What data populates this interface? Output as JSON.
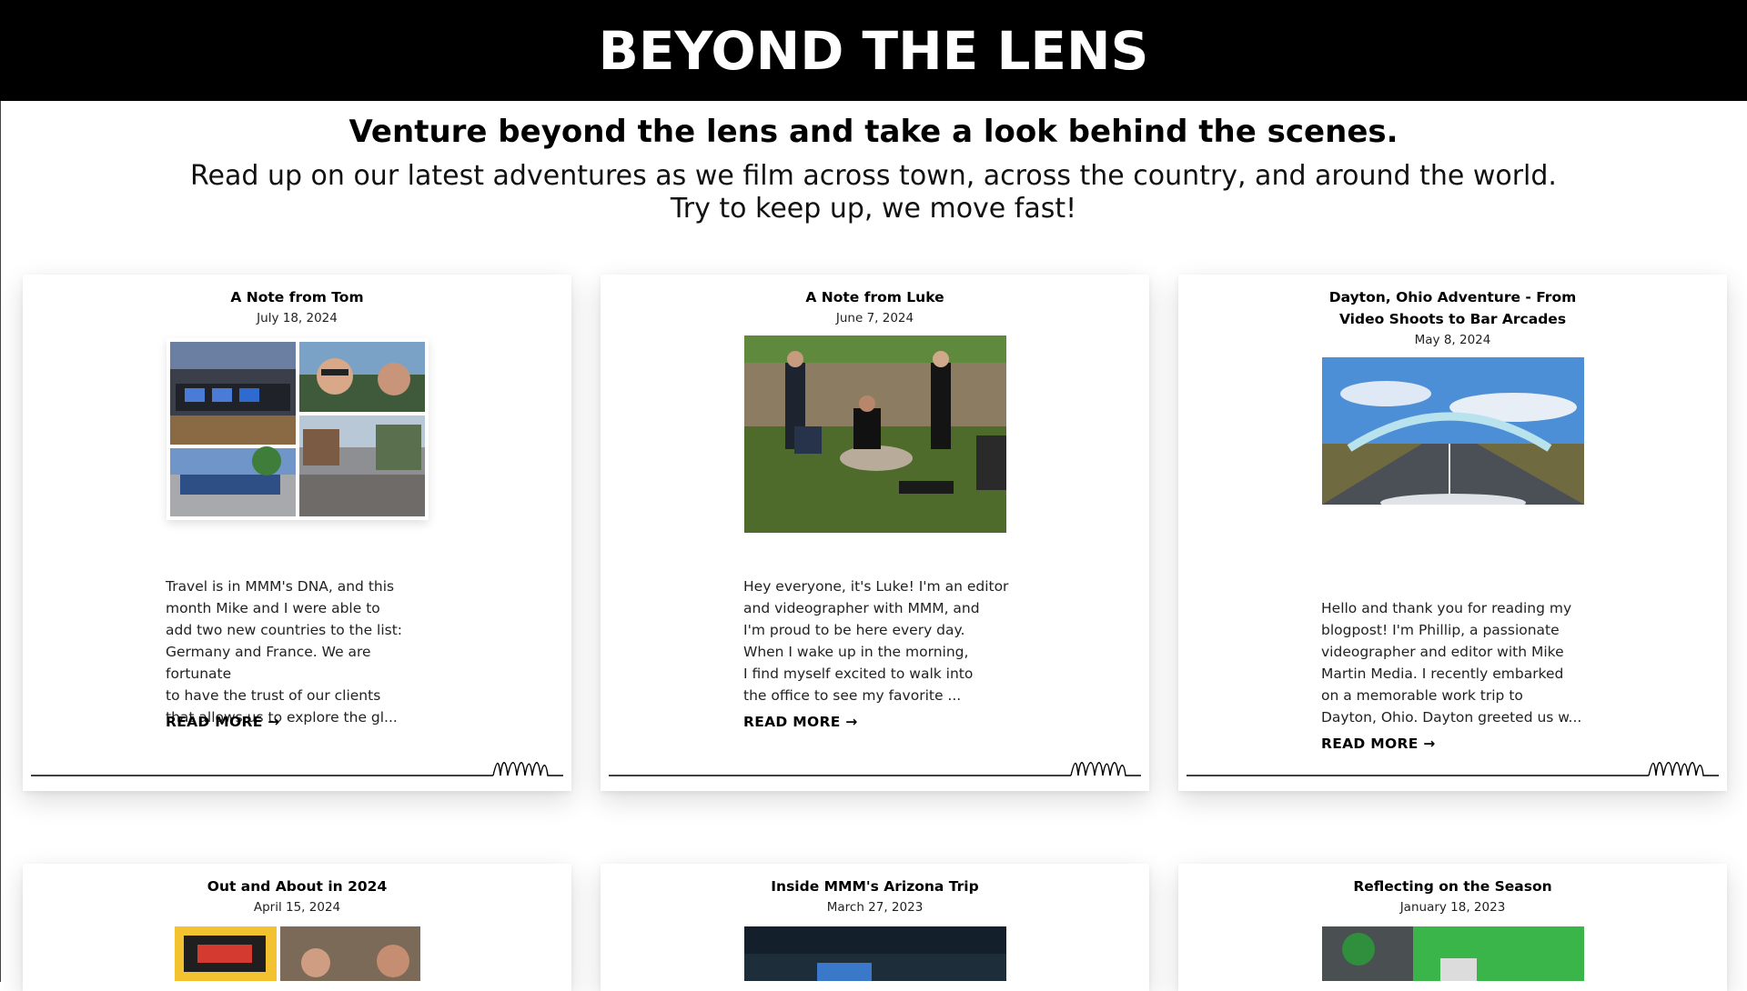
{
  "header": {
    "title": "BEYOND THE LENS"
  },
  "intro": {
    "tagline": "Venture beyond the lens and take a look behind the scenes.",
    "line1": "Read up on our latest adventures as we film across town, across the country, and around the world.",
    "line2": "Try to keep up, we move fast!"
  },
  "posts": [
    {
      "title": "A Note from Tom",
      "date": "July 18, 2024",
      "excerpt": [
        "Travel is in MMM's DNA, and this",
        "month Mike and I were able to",
        "add two new countries to the list:",
        "Germany and France. We are fortunate",
        "to have the trust of our clients",
        "that allows us to explore the gl..."
      ],
      "read_more": "READ MORE →"
    },
    {
      "title": "A Note from Luke",
      "date": "June 7, 2024",
      "excerpt": [
        "Hey everyone, it's Luke! I'm an editor",
        "and videographer with MMM, and",
        "I'm proud to be here every day.",
        "When I wake up in the morning,",
        "I find myself excited to walk into",
        "the office to see my favorite ..."
      ],
      "read_more": "READ MORE →"
    },
    {
      "title": "Dayton, Ohio Adventure - From Video Shoots to Bar Arcades",
      "date": "May 8, 2024",
      "excerpt": [
        "Hello and thank you for reading my",
        "blogpost! I'm Phillip, a passionate",
        "videographer and editor with Mike",
        "Martin Media. I recently embarked",
        "on a memorable work trip to",
        "Dayton, Ohio. Dayton greeted us w..."
      ],
      "read_more": "READ MORE →"
    },
    {
      "title": "Out and About in 2024",
      "date": "April 15, 2024"
    },
    {
      "title": "Inside MMM's Arizona Trip",
      "date": "March 27, 2023"
    },
    {
      "title": "Reflecting on the Season",
      "date": "January 18, 2023"
    }
  ],
  "signature": "MMM"
}
